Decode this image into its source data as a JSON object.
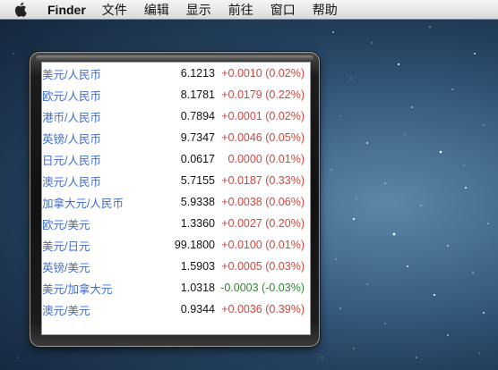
{
  "menubar": {
    "app_name": "Finder",
    "menus": [
      "文件",
      "编辑",
      "显示",
      "前往",
      "窗口",
      "帮助"
    ]
  },
  "widget": {
    "rows": [
      {
        "pair": "美元/人民币",
        "rate": "6.1213",
        "change": "+0.0010 (0.02%)",
        "dir": "up"
      },
      {
        "pair": "欧元/人民币",
        "rate": "8.1781",
        "change": "+0.0179 (0.22%)",
        "dir": "up"
      },
      {
        "pair": "港币/人民币",
        "rate": "0.7894",
        "change": "+0.0001 (0.02%)",
        "dir": "up"
      },
      {
        "pair": "英镑/人民币",
        "rate": "9.7347",
        "change": "+0.0046 (0.05%)",
        "dir": "up"
      },
      {
        "pair": "日元/人民币",
        "rate": "0.0617",
        "change": "0.0000 (0.01%)",
        "dir": "up"
      },
      {
        "pair": "澳元/人民币",
        "rate": "5.7155",
        "change": "+0.0187 (0.33%)",
        "dir": "up"
      },
      {
        "pair": "加拿大元/人民币",
        "rate": "5.9338",
        "change": "+0.0038 (0.06%)",
        "dir": "up"
      },
      {
        "pair": "欧元/美元",
        "rate": "1.3360",
        "change": "+0.0027 (0.20%)",
        "dir": "up"
      },
      {
        "pair": "美元/日元",
        "rate": "99.1800",
        "change": "+0.0100 (0.01%)",
        "dir": "up"
      },
      {
        "pair": "英镑/美元",
        "rate": "1.5903",
        "change": "+0.0005 (0.03%)",
        "dir": "up"
      },
      {
        "pair": "美元/加拿大元",
        "rate": "1.0318",
        "change": "-0.0003 (-0.03%)",
        "dir": "down"
      },
      {
        "pair": "澳元/美元",
        "rate": "0.9344",
        "change": "+0.0036 (0.39%)",
        "dir": "up"
      }
    ]
  },
  "colors": {
    "pair_text": "#3f6dd1",
    "positive_change": "#d2453b",
    "negative_change": "#2a8a2a"
  }
}
